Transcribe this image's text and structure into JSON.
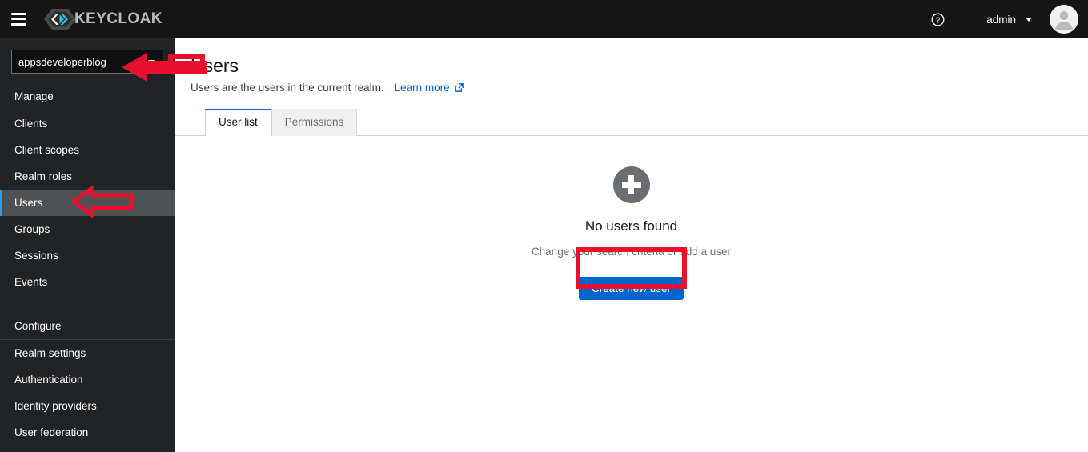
{
  "masthead": {
    "menu_icon": "hamburger-menu-icon",
    "brand_text": "KEYCLOAK",
    "logo_icon": "keycloak-hexagon-logo",
    "help_icon": "help-circle-icon",
    "user_name": "admin",
    "user_caret_icon": "caret-down-icon",
    "avatar_icon": "user-avatar-icon"
  },
  "sidebar": {
    "realm_selector": {
      "value": "appsdeveloperblog",
      "caret_icon": "caret-down-icon"
    },
    "sections": [
      {
        "title": "Manage",
        "items": [
          {
            "label": "Clients",
            "active": false
          },
          {
            "label": "Client scopes",
            "active": false
          },
          {
            "label": "Realm roles",
            "active": false
          },
          {
            "label": "Users",
            "active": true
          },
          {
            "label": "Groups",
            "active": false
          },
          {
            "label": "Sessions",
            "active": false
          },
          {
            "label": "Events",
            "active": false
          }
        ]
      },
      {
        "title": "Configure",
        "items": [
          {
            "label": "Realm settings",
            "active": false
          },
          {
            "label": "Authentication",
            "active": false
          },
          {
            "label": "Identity providers",
            "active": false
          },
          {
            "label": "User federation",
            "active": false
          }
        ]
      }
    ]
  },
  "main": {
    "page_title": "Users",
    "page_subtitle": "Users are the users in the current realm.",
    "learn_more_label": "Learn more",
    "learn_more_icon": "external-link-icon",
    "tabs": [
      {
        "label": "User list",
        "active": true
      },
      {
        "label": "Permissions",
        "active": false
      }
    ],
    "empty_state": {
      "icon": "plus-circle-icon",
      "title": "No users found",
      "subtitle": "Change your search criteria or add a user",
      "button_label": "Create new user"
    }
  },
  "annotations": {
    "color": "#e8112d",
    "items": [
      {
        "name": "realm-selector-callout-arrow",
        "shape": "arrow-left"
      },
      {
        "name": "realm-selector-callout-rect",
        "shape": "rectangle"
      },
      {
        "name": "users-nav-callout-arrow",
        "shape": "arrow-left"
      },
      {
        "name": "create-new-user-callout-rect",
        "shape": "rectangle"
      }
    ]
  },
  "colors": {
    "accent_blue": "#0066cc",
    "active_nav_blue": "#2b9af3",
    "masthead_bg": "#151515",
    "sidebar_bg": "#212427",
    "annotation_red": "#e8112d"
  }
}
